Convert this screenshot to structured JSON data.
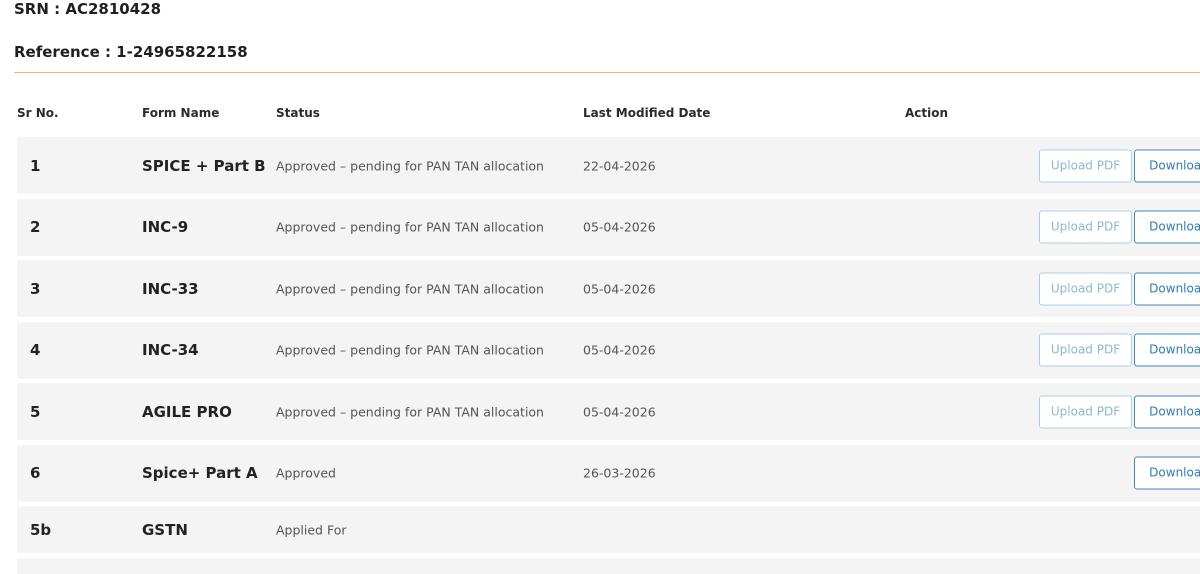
{
  "header": {
    "srn": "SRN : AC2810428",
    "reference": "Reference : 1-24965822158"
  },
  "table": {
    "columns": {
      "sr_no": "Sr No.",
      "form_name": "Form Name",
      "status": "Status",
      "last_modified": "Last Modified Date",
      "action": "Action"
    },
    "rows": [
      {
        "sr": "1",
        "form": "SPICE + Part B",
        "status": "Approved – pending for PAN TAN allocation",
        "date": "22-04-2026",
        "upload": "Upload PDF",
        "download": "Download"
      },
      {
        "sr": "2",
        "form": "INC-9",
        "status": "Approved – pending for PAN TAN allocation",
        "date": "05-04-2026",
        "upload": "Upload PDF",
        "download": "Download"
      },
      {
        "sr": "3",
        "form": "INC-33",
        "status": "Approved – pending for PAN TAN allocation",
        "date": "05-04-2026",
        "upload": "Upload PDF",
        "download": "Download"
      },
      {
        "sr": "4",
        "form": "INC-34",
        "status": "Approved – pending for PAN TAN allocation",
        "date": "05-04-2026",
        "upload": "Upload PDF",
        "download": "Download"
      },
      {
        "sr": "5",
        "form": "AGILE PRO",
        "status": "Approved – pending for PAN TAN allocation",
        "date": "05-04-2026",
        "upload": "Upload PDF",
        "download": "Download"
      },
      {
        "sr": "6",
        "form": "Spice+ Part A",
        "status": "Approved",
        "date": "26-03-2026",
        "download": "Download"
      },
      {
        "sr": "5b",
        "form": "GSTN",
        "status": "Applied For"
      }
    ]
  },
  "colors": {
    "accent_divider": "#f0b866",
    "row_background": "#f4f4f4",
    "button_primary_border": "#3a87c0",
    "button_disabled_border": "#a9cfe6"
  }
}
